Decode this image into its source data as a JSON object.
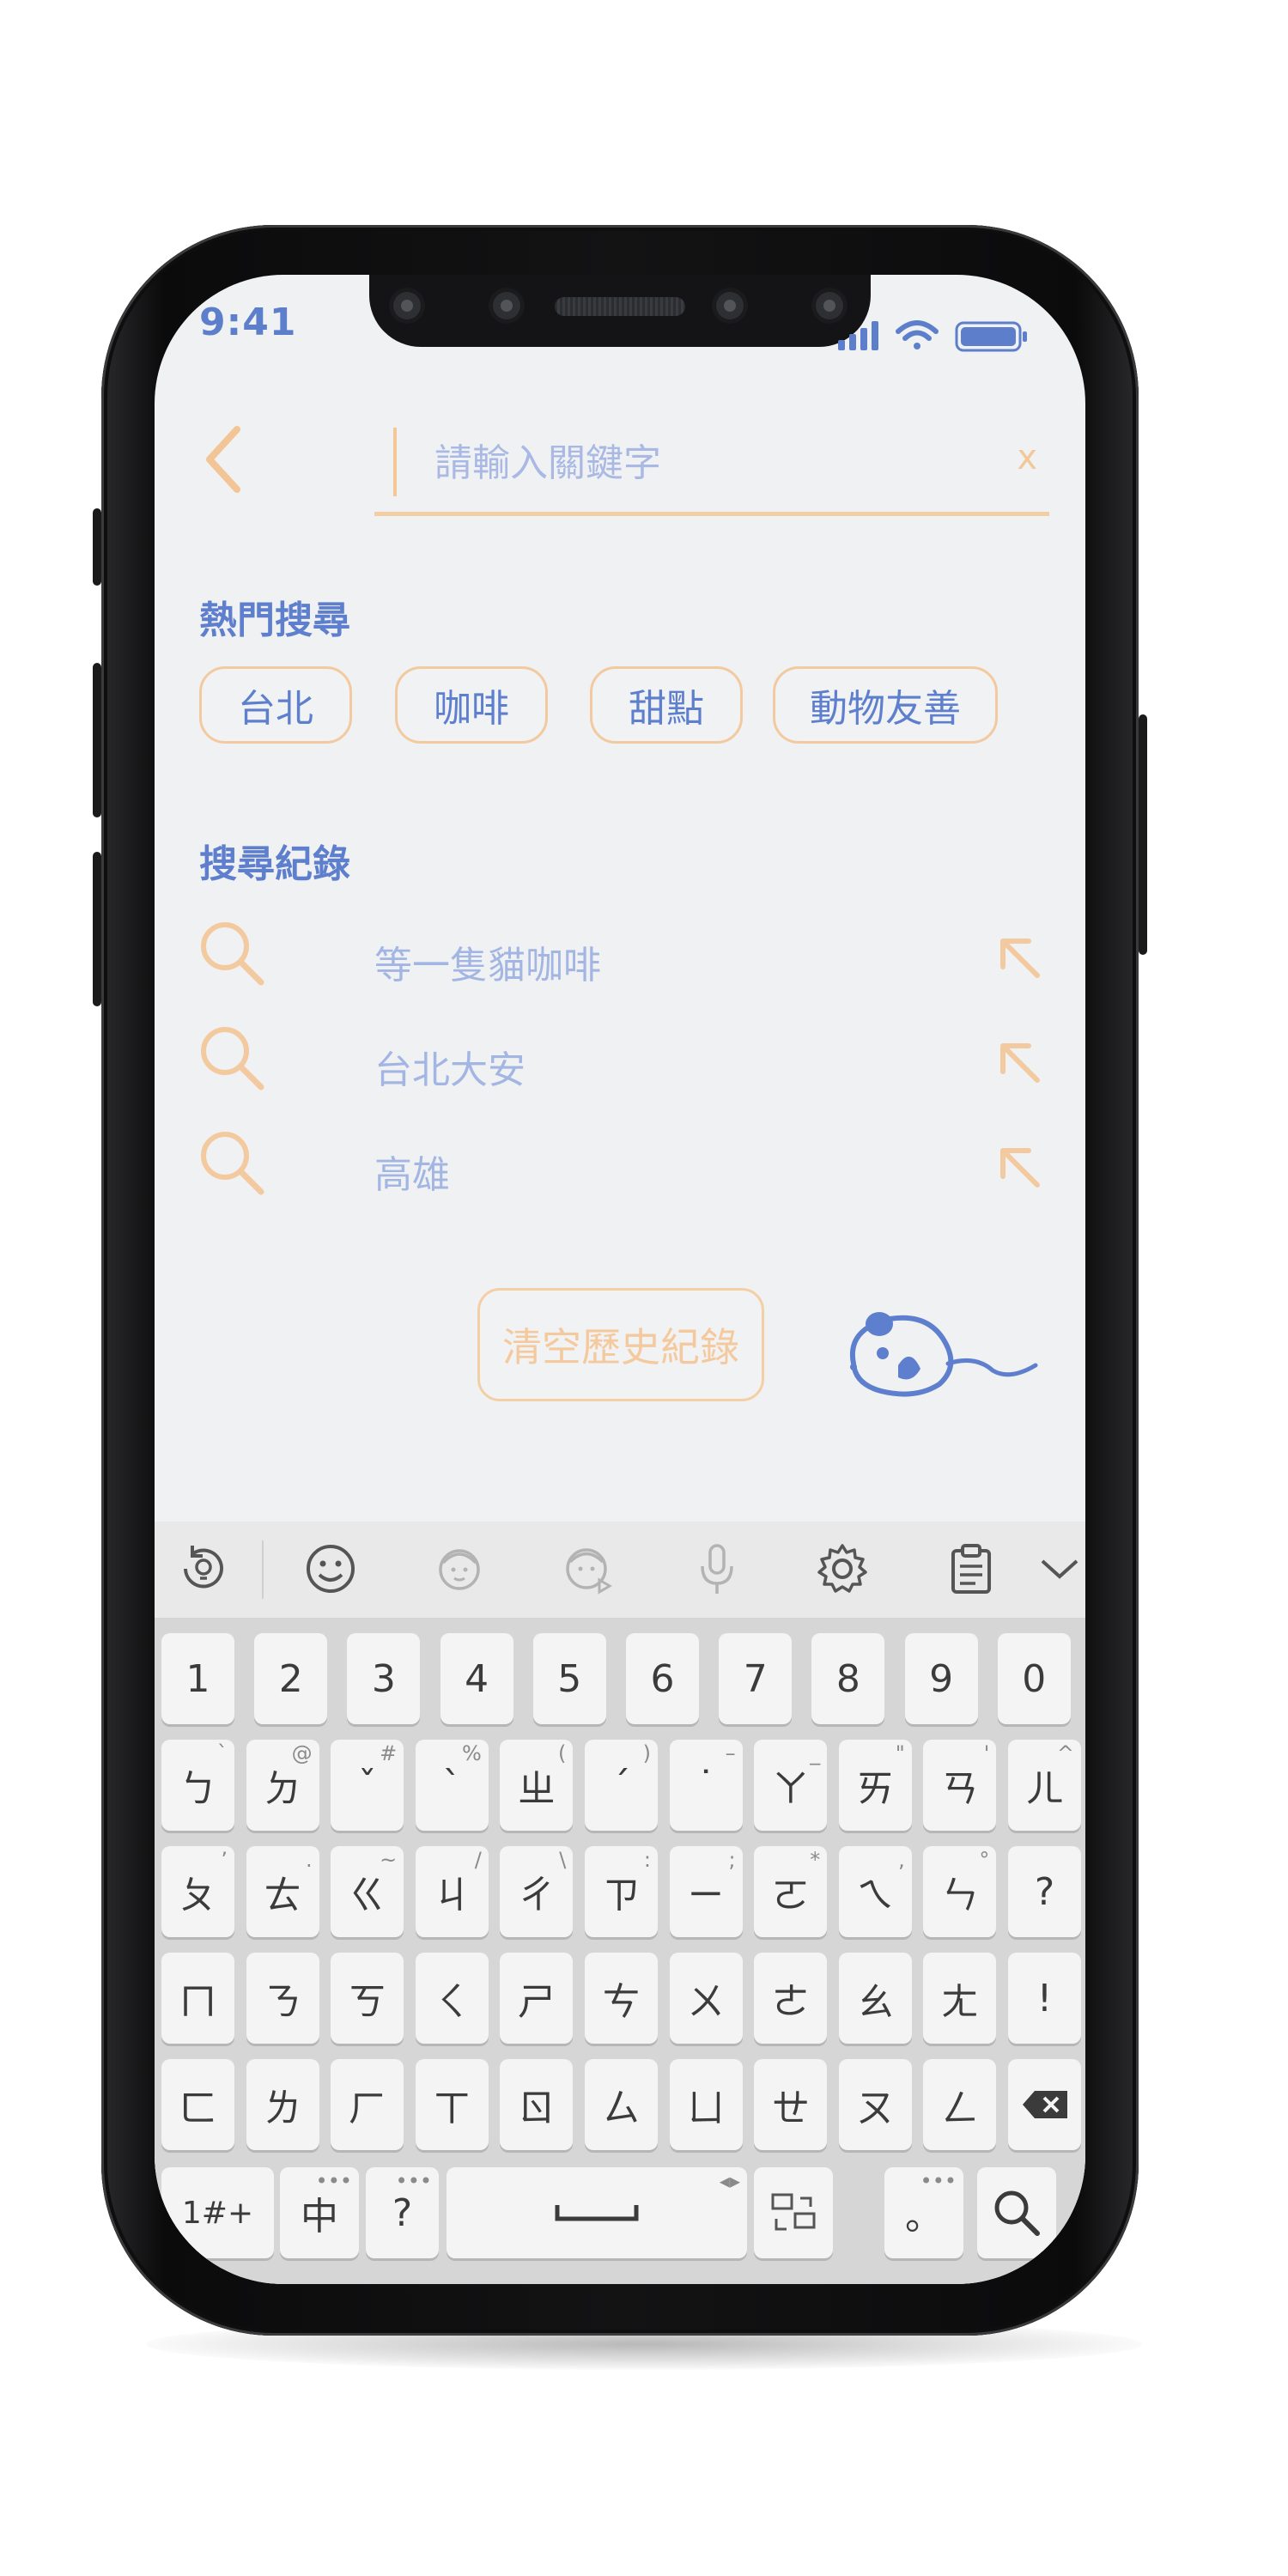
{
  "status_bar": {
    "time": "9:41"
  },
  "search": {
    "placeholder": "請輸入關鍵字",
    "clear_label": "x"
  },
  "hot_searches": {
    "title": "熱門搜尋",
    "chips": [
      "台北",
      "咖啡",
      "甜點",
      "動物友善"
    ]
  },
  "history": {
    "title": "搜尋紀錄",
    "items": [
      "等一隻貓咖啡",
      "台北大安",
      "高雄"
    ],
    "clear_label": "清空歷史紀錄"
  },
  "keyboard": {
    "toolbar_icons": [
      "refresh-bulb-icon",
      "emoji-icon",
      "sticker-face-icon",
      "animated-sticker-icon",
      "microphone-icon",
      "settings-icon",
      "clipboard-icon",
      "collapse-icon"
    ],
    "row_numbers": [
      "1",
      "2",
      "3",
      "4",
      "5",
      "6",
      "7",
      "8",
      "9",
      "0"
    ],
    "row1": [
      [
        "ㄅ",
        "`"
      ],
      [
        "ㄉ",
        "@"
      ],
      [
        "ˇ",
        "#"
      ],
      [
        "ˋ",
        "%"
      ],
      [
        "ㄓ",
        "("
      ],
      [
        "ˊ",
        ")"
      ],
      [
        "˙",
        "–"
      ],
      [
        "ㄚ",
        "_"
      ],
      [
        "ㄞ",
        "\""
      ],
      [
        "ㄢ",
        "'"
      ],
      [
        "ㄦ",
        "^"
      ]
    ],
    "row2": [
      [
        "ㄆ",
        "’"
      ],
      [
        "ㄊ",
        "."
      ],
      [
        "ㄍ",
        "~"
      ],
      [
        "ㄐ",
        "/"
      ],
      [
        "ㄔ",
        "\\"
      ],
      [
        "ㄗ",
        ":"
      ],
      [
        "ㄧ",
        ";"
      ],
      [
        "ㄛ",
        "*"
      ],
      [
        "ㄟ",
        ","
      ],
      [
        "ㄣ",
        "°"
      ],
      [
        "?",
        ""
      ]
    ],
    "row3": [
      [
        "ㄇ",
        ""
      ],
      [
        "ㄋ",
        ""
      ],
      [
        "ㄎ",
        ""
      ],
      [
        "ㄑ",
        ""
      ],
      [
        "ㄕ",
        ""
      ],
      [
        "ㄘ",
        ""
      ],
      [
        "ㄨ",
        ""
      ],
      [
        "ㄜ",
        ""
      ],
      [
        "ㄠ",
        ""
      ],
      [
        "ㄤ",
        ""
      ],
      [
        "!",
        ""
      ]
    ],
    "row4": [
      [
        "ㄈ",
        ""
      ],
      [
        "ㄌ",
        ""
      ],
      [
        "ㄏ",
        ""
      ],
      [
        "ㄒ",
        ""
      ],
      [
        "ㄖ",
        ""
      ],
      [
        "ㄙ",
        ""
      ],
      [
        "ㄩ",
        ""
      ],
      [
        "ㄝ",
        ""
      ],
      [
        "ㄡ",
        ""
      ],
      [
        "ㄥ",
        ""
      ]
    ],
    "bottom": {
      "symbols": "1#+",
      "lang": "中",
      "question": "?",
      "period": "。"
    }
  },
  "colors": {
    "accent_blue": "#5e7fcd",
    "accent_peach": "#f3c9a0",
    "screen_bg": "#f0f1f2"
  }
}
